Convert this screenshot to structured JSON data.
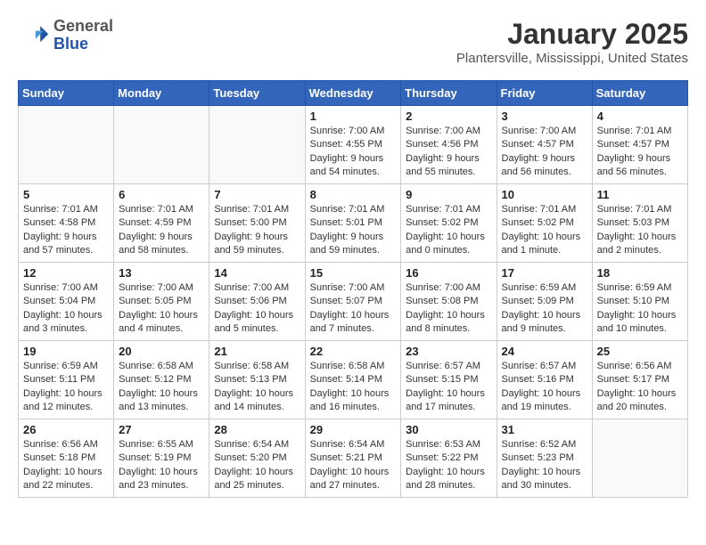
{
  "header": {
    "logo_general": "General",
    "logo_blue": "Blue",
    "month_title": "January 2025",
    "location": "Plantersville, Mississippi, United States"
  },
  "days_of_week": [
    "Sunday",
    "Monday",
    "Tuesday",
    "Wednesday",
    "Thursday",
    "Friday",
    "Saturday"
  ],
  "weeks": [
    [
      {
        "day": "",
        "sunrise": "",
        "sunset": "",
        "daylight": ""
      },
      {
        "day": "",
        "sunrise": "",
        "sunset": "",
        "daylight": ""
      },
      {
        "day": "",
        "sunrise": "",
        "sunset": "",
        "daylight": ""
      },
      {
        "day": "1",
        "sunrise": "Sunrise: 7:00 AM",
        "sunset": "Sunset: 4:55 PM",
        "daylight": "Daylight: 9 hours and 54 minutes."
      },
      {
        "day": "2",
        "sunrise": "Sunrise: 7:00 AM",
        "sunset": "Sunset: 4:56 PM",
        "daylight": "Daylight: 9 hours and 55 minutes."
      },
      {
        "day": "3",
        "sunrise": "Sunrise: 7:00 AM",
        "sunset": "Sunset: 4:57 PM",
        "daylight": "Daylight: 9 hours and 56 minutes."
      },
      {
        "day": "4",
        "sunrise": "Sunrise: 7:01 AM",
        "sunset": "Sunset: 4:57 PM",
        "daylight": "Daylight: 9 hours and 56 minutes."
      }
    ],
    [
      {
        "day": "5",
        "sunrise": "Sunrise: 7:01 AM",
        "sunset": "Sunset: 4:58 PM",
        "daylight": "Daylight: 9 hours and 57 minutes."
      },
      {
        "day": "6",
        "sunrise": "Sunrise: 7:01 AM",
        "sunset": "Sunset: 4:59 PM",
        "daylight": "Daylight: 9 hours and 58 minutes."
      },
      {
        "day": "7",
        "sunrise": "Sunrise: 7:01 AM",
        "sunset": "Sunset: 5:00 PM",
        "daylight": "Daylight: 9 hours and 59 minutes."
      },
      {
        "day": "8",
        "sunrise": "Sunrise: 7:01 AM",
        "sunset": "Sunset: 5:01 PM",
        "daylight": "Daylight: 9 hours and 59 minutes."
      },
      {
        "day": "9",
        "sunrise": "Sunrise: 7:01 AM",
        "sunset": "Sunset: 5:02 PM",
        "daylight": "Daylight: 10 hours and 0 minutes."
      },
      {
        "day": "10",
        "sunrise": "Sunrise: 7:01 AM",
        "sunset": "Sunset: 5:02 PM",
        "daylight": "Daylight: 10 hours and 1 minute."
      },
      {
        "day": "11",
        "sunrise": "Sunrise: 7:01 AM",
        "sunset": "Sunset: 5:03 PM",
        "daylight": "Daylight: 10 hours and 2 minutes."
      }
    ],
    [
      {
        "day": "12",
        "sunrise": "Sunrise: 7:00 AM",
        "sunset": "Sunset: 5:04 PM",
        "daylight": "Daylight: 10 hours and 3 minutes."
      },
      {
        "day": "13",
        "sunrise": "Sunrise: 7:00 AM",
        "sunset": "Sunset: 5:05 PM",
        "daylight": "Daylight: 10 hours and 4 minutes."
      },
      {
        "day": "14",
        "sunrise": "Sunrise: 7:00 AM",
        "sunset": "Sunset: 5:06 PM",
        "daylight": "Daylight: 10 hours and 5 minutes."
      },
      {
        "day": "15",
        "sunrise": "Sunrise: 7:00 AM",
        "sunset": "Sunset: 5:07 PM",
        "daylight": "Daylight: 10 hours and 7 minutes."
      },
      {
        "day": "16",
        "sunrise": "Sunrise: 7:00 AM",
        "sunset": "Sunset: 5:08 PM",
        "daylight": "Daylight: 10 hours and 8 minutes."
      },
      {
        "day": "17",
        "sunrise": "Sunrise: 6:59 AM",
        "sunset": "Sunset: 5:09 PM",
        "daylight": "Daylight: 10 hours and 9 minutes."
      },
      {
        "day": "18",
        "sunrise": "Sunrise: 6:59 AM",
        "sunset": "Sunset: 5:10 PM",
        "daylight": "Daylight: 10 hours and 10 minutes."
      }
    ],
    [
      {
        "day": "19",
        "sunrise": "Sunrise: 6:59 AM",
        "sunset": "Sunset: 5:11 PM",
        "daylight": "Daylight: 10 hours and 12 minutes."
      },
      {
        "day": "20",
        "sunrise": "Sunrise: 6:58 AM",
        "sunset": "Sunset: 5:12 PM",
        "daylight": "Daylight: 10 hours and 13 minutes."
      },
      {
        "day": "21",
        "sunrise": "Sunrise: 6:58 AM",
        "sunset": "Sunset: 5:13 PM",
        "daylight": "Daylight: 10 hours and 14 minutes."
      },
      {
        "day": "22",
        "sunrise": "Sunrise: 6:58 AM",
        "sunset": "Sunset: 5:14 PM",
        "daylight": "Daylight: 10 hours and 16 minutes."
      },
      {
        "day": "23",
        "sunrise": "Sunrise: 6:57 AM",
        "sunset": "Sunset: 5:15 PM",
        "daylight": "Daylight: 10 hours and 17 minutes."
      },
      {
        "day": "24",
        "sunrise": "Sunrise: 6:57 AM",
        "sunset": "Sunset: 5:16 PM",
        "daylight": "Daylight: 10 hours and 19 minutes."
      },
      {
        "day": "25",
        "sunrise": "Sunrise: 6:56 AM",
        "sunset": "Sunset: 5:17 PM",
        "daylight": "Daylight: 10 hours and 20 minutes."
      }
    ],
    [
      {
        "day": "26",
        "sunrise": "Sunrise: 6:56 AM",
        "sunset": "Sunset: 5:18 PM",
        "daylight": "Daylight: 10 hours and 22 minutes."
      },
      {
        "day": "27",
        "sunrise": "Sunrise: 6:55 AM",
        "sunset": "Sunset: 5:19 PM",
        "daylight": "Daylight: 10 hours and 23 minutes."
      },
      {
        "day": "28",
        "sunrise": "Sunrise: 6:54 AM",
        "sunset": "Sunset: 5:20 PM",
        "daylight": "Daylight: 10 hours and 25 minutes."
      },
      {
        "day": "29",
        "sunrise": "Sunrise: 6:54 AM",
        "sunset": "Sunset: 5:21 PM",
        "daylight": "Daylight: 10 hours and 27 minutes."
      },
      {
        "day": "30",
        "sunrise": "Sunrise: 6:53 AM",
        "sunset": "Sunset: 5:22 PM",
        "daylight": "Daylight: 10 hours and 28 minutes."
      },
      {
        "day": "31",
        "sunrise": "Sunrise: 6:52 AM",
        "sunset": "Sunset: 5:23 PM",
        "daylight": "Daylight: 10 hours and 30 minutes."
      },
      {
        "day": "",
        "sunrise": "",
        "sunset": "",
        "daylight": ""
      }
    ]
  ]
}
